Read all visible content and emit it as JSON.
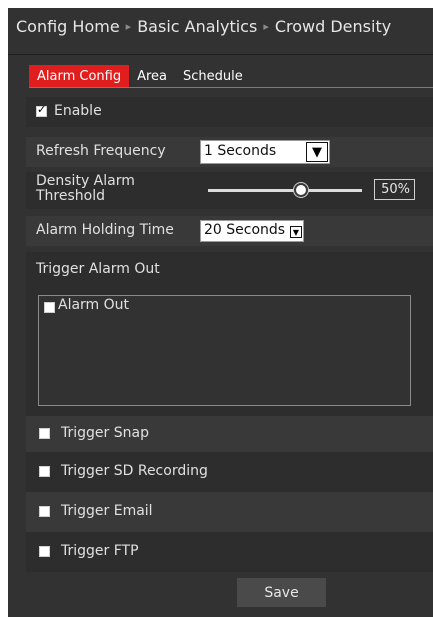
{
  "breadcrumb": {
    "items": [
      "Config Home",
      "Basic Analytics",
      "Crowd Density"
    ],
    "separator": "▸"
  },
  "tabs": [
    {
      "label": "Alarm Config",
      "active": true
    },
    {
      "label": "Area",
      "active": false
    },
    {
      "label": "Schedule",
      "active": false
    }
  ],
  "enable": {
    "label": "Enable",
    "checked": true
  },
  "refresh_frequency": {
    "label": "Refresh Frequency",
    "value": "1 Seconds"
  },
  "density_threshold": {
    "label": "Density Alarm Threshold",
    "value": "50%",
    "level_percent": 50
  },
  "alarm_holding": {
    "label": "Alarm Holding Time",
    "value": "20 Seconds"
  },
  "trigger_alarm_out": {
    "label": "Trigger Alarm Out",
    "items": [
      {
        "label": "Alarm Out",
        "checked": false
      }
    ]
  },
  "triggers": [
    {
      "label": "Trigger Snap",
      "checked": false
    },
    {
      "label": "Trigger SD Recording",
      "checked": false
    },
    {
      "label": "Trigger Email",
      "checked": false
    },
    {
      "label": "Trigger FTP",
      "checked": false
    }
  ],
  "save_label": "Save",
  "colors": {
    "active_tab": "#e01e1e",
    "panel": "#323232"
  }
}
